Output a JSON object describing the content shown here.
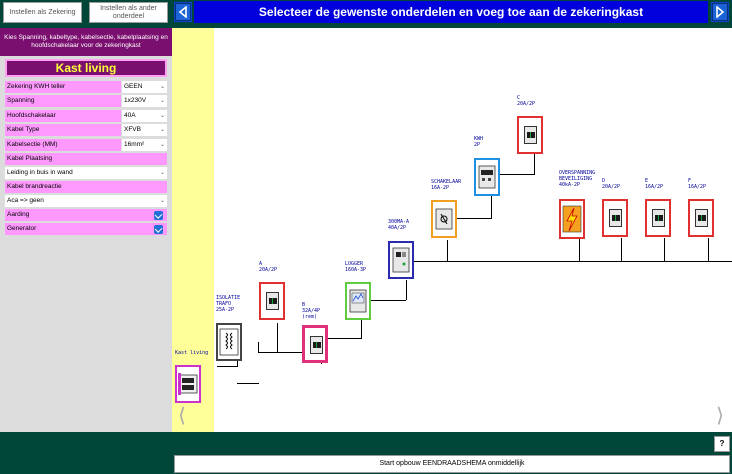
{
  "top_buttons": {
    "save_fuse": "Instellen als Zekering",
    "save_other": "Instellen als ander onderdeel"
  },
  "header": {
    "title": "Selecteer de gewenste onderdelen en voeg toe aan de zekeringkast"
  },
  "panel": {
    "instruction": "Kies Spanning, kabeltype, kabelsectie, kabelplaatsing en hoofdschakelaar voor de zekeringkast",
    "cabinet_title": "Kast living",
    "fields": [
      {
        "label": "Zekering KWH teller",
        "value": "GEEN"
      },
      {
        "label": "Spanning",
        "value": "1x230V"
      },
      {
        "label": "Hoofdschakelaar",
        "value": "40A"
      },
      {
        "label": "Kabel Type",
        "value": "XFVB"
      },
      {
        "label": "Kabelsectie (MM)",
        "value": "16mm²"
      }
    ],
    "kabel_plaatsing": {
      "label": "Kabel Plaatsing",
      "value": "Leiding in buis in wand"
    },
    "kabel_brandreactie": {
      "label": "Kabel brandreactie",
      "value": "Aca => geen"
    },
    "aarding": {
      "label": "Aarding",
      "checked": true
    },
    "generator": {
      "label": "Generator",
      "checked": true
    }
  },
  "canvas": {
    "components": [
      {
        "id": "kast",
        "label": "Kast living",
        "color": "#cc33cc"
      },
      {
        "id": "trafo",
        "label": "ISOLATIE\nTRAFO\n25A-2P",
        "color": "#444444"
      },
      {
        "id": "a",
        "label": "A\n20A/2P",
        "color": "#e03030"
      },
      {
        "id": "b",
        "label": "B\n32A/4P\n(rem)",
        "color": "#e0307a"
      },
      {
        "id": "logger",
        "label": "LOGGER\n160A-3P",
        "color": "#60cc40"
      },
      {
        "id": "diff",
        "label": "300MA-A\n40A/2P",
        "color": "#2a2ab0"
      },
      {
        "id": "schakelaar",
        "label": "SCHAKELAAR\n16A-2P",
        "color": "#f0a020"
      },
      {
        "id": "kwh",
        "label": "KWH\n2P",
        "color": "#2090e0"
      },
      {
        "id": "c",
        "label": "C\n20A/2P",
        "color": "#e03030"
      },
      {
        "id": "overspanning",
        "label": "OVERSPANNING\nBEVEILIGING\n40kA-2P",
        "color": "#e03030"
      },
      {
        "id": "d",
        "label": "D\n20A/2P",
        "color": "#e03030"
      },
      {
        "id": "e",
        "label": "E\n16A/2P",
        "color": "#e03030"
      },
      {
        "id": "f",
        "label": "F\n16A/2P",
        "color": "#e03030"
      }
    ]
  },
  "bottom": {
    "help": "?",
    "start": "Start opbouw EENDRAADSHEMA onmiddellijk"
  }
}
